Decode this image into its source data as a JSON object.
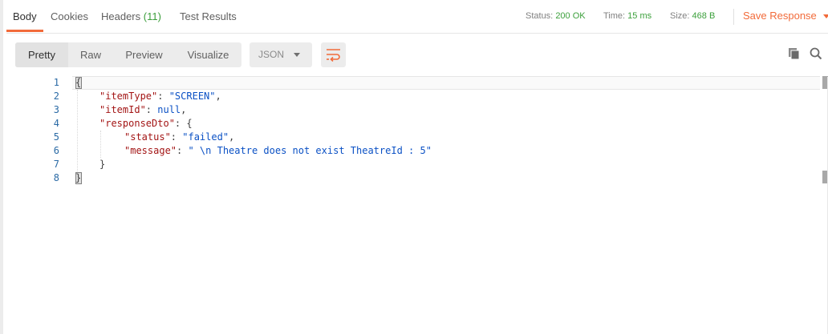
{
  "tabs": {
    "body": "Body",
    "cookies": "Cookies",
    "headers": "Headers",
    "headers_count": "(11)",
    "test_results": "Test Results"
  },
  "status": {
    "status_label": "Status:",
    "status_value": "200 OK",
    "time_label": "Time:",
    "time_value": "15 ms",
    "size_label": "Size:",
    "size_value": "468 B"
  },
  "save_response": "Save Response",
  "view_modes": {
    "pretty": "Pretty",
    "raw": "Raw",
    "preview": "Preview",
    "visualize": "Visualize"
  },
  "format_select": "JSON",
  "code": {
    "line_numbers": [
      "1",
      "2",
      "3",
      "4",
      "5",
      "6",
      "7",
      "8"
    ],
    "line1": "{",
    "line2_key": "\"itemType\"",
    "line2_sep": ": ",
    "line2_val": "\"SCREEN\"",
    "line2_end": ",",
    "line3_key": "\"itemId\"",
    "line3_sep": ": ",
    "line3_val": "null",
    "line3_end": ",",
    "line4_key": "\"responseDto\"",
    "line4_rest": ": {",
    "line5_key": "\"status\"",
    "line5_sep": ": ",
    "line5_val": "\"failed\"",
    "line5_end": ",",
    "line6_key": "\"message\"",
    "line6_sep": ": ",
    "line6_val": "\" \\n Theatre does not exist TheatreId : 5\"",
    "line7": "}",
    "line8": "}"
  },
  "colors": {
    "accent": "#f26b3a",
    "status_ok": "#3ca03c",
    "json_key": "#a31515",
    "json_value": "#0b51c5"
  },
  "icons": {
    "wrap": "wrap-lines-icon",
    "copy": "copy-icon",
    "search": "search-icon"
  }
}
